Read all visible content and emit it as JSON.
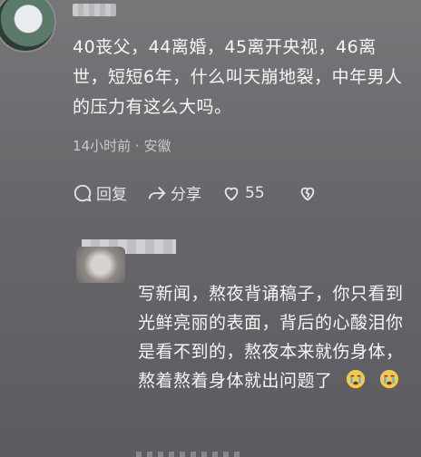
{
  "comment": {
    "text": "40丧父，44离婚，45离开央视，46离世，短短6年，什么叫天崩地裂，中年男人的压力有这么大吗。",
    "time": "14小时前",
    "separator": "·",
    "location": "安徽",
    "reply_label": "回复",
    "share_label": "分享",
    "like_count": "55"
  },
  "reply": {
    "text": "写新闻，熬夜背诵稿子，你只看到光鲜亮丽的表面，背后的心酸泪你是看不到的，熬夜本来就伤身体，熬着熬着身体就出问题了",
    "emoji_1": "crying-face",
    "emoji_2": "crying-face"
  }
}
